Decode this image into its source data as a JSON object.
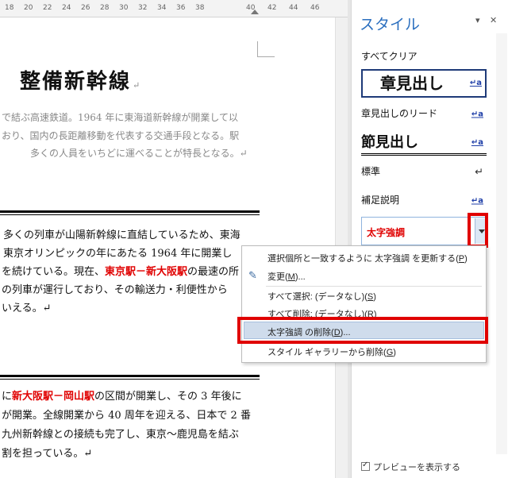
{
  "ruler": {
    "ticks": [
      "18",
      "20",
      "22",
      "24",
      "26",
      "28",
      "30",
      "32",
      "34",
      "36",
      "38",
      "40",
      "42",
      "44",
      "46"
    ]
  },
  "document": {
    "title": "整備新幹線",
    "para_mark": "↵",
    "lead_lines": [
      "で結ぶ高速鉄道。1964 年に東海道新幹線が開業して以",
      "おり、国内の長距離移動を代表する交通手段となる。駅",
      "多くの人員をいちどに運べることが特長となる。↵"
    ],
    "section1": {
      "line1": "多くの列車が山陽新幹線に直結しているため、東海",
      "line2": "東京オリンピックの年にあたる 1964 年に開業し",
      "line3_pre": "を続けている。現在、",
      "line3_red": "東京駅－新大阪駅",
      "line3_post": "の最速の所",
      "line4": "の列車が運行しており、その輸送力・利便性から",
      "line5": "いえる。↵"
    },
    "section2": {
      "line1_pre": "に",
      "line1_red": "新大阪駅－岡山駅",
      "line1_post": "の区間が開業し、その 3 年後に",
      "line2": "が開業。全線開業から 40 周年を迎える、日本で 2 番",
      "line3": "九州新幹線との接続も完了し、東京～鹿児島を結ぶ",
      "line4": "割を担っている。↵"
    }
  },
  "styles_pane": {
    "title": "スタイル",
    "controls": [
      "▾",
      "✕"
    ],
    "items": {
      "clear_all": "すべてクリア",
      "chapter_heading": "章見出し",
      "chapter_lead": "章見出しのリード",
      "section_heading": "節見出し",
      "normal": "標準",
      "supplement": "補足説明",
      "bold_emphasis": "太字強調"
    },
    "char_icon": "↵a",
    "para_icon": "↵",
    "preview_label": "プレビューを表示する"
  },
  "context_menu": {
    "items": [
      {
        "text": "選択個所と一致するように 太字強調 を更新する(",
        "key": "P",
        "tail": ")"
      },
      {
        "text": "変更(",
        "key": "M",
        "tail": ")..."
      },
      {
        "text": "すべて選択: (データなし)(",
        "key": "S",
        "tail": ")"
      },
      {
        "text": "すべて削除: (データなし)(",
        "key": "R",
        "tail": ")"
      },
      {
        "text": "太字強調 の削除(",
        "key": "D",
        "tail": ")..."
      },
      {
        "text": "スタイル ギャラリーから削除(",
        "key": "G",
        "tail": ")"
      }
    ]
  },
  "colors": {
    "accent": "#2b6fbf",
    "highlight": "#e00000",
    "menu_hover": "#cfdcec"
  }
}
